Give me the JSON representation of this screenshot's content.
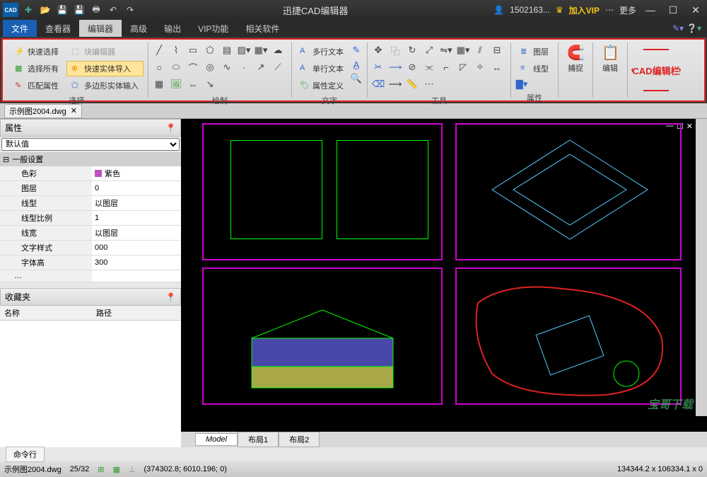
{
  "title": "迅捷CAD编辑器",
  "user": "1502163...",
  "vip_label": "加入VIP",
  "more_label": "更多",
  "menu": {
    "file": "文件",
    "items": [
      "查看器",
      "编辑器",
      "高级",
      "输出",
      "VIP功能",
      "相关软件"
    ],
    "active_index": 1
  },
  "ribbon": {
    "select": {
      "label": "选择",
      "quick_select": "快速选择",
      "block_editor": "块编辑器",
      "select_all": "选择所有",
      "quick_import": "快速实体导入",
      "match_props": "匹配属性",
      "poly_input": "多边形实体输入"
    },
    "draw": {
      "label": "绘制"
    },
    "text": {
      "label": "文字",
      "multiline": "多行文本",
      "single": "单行文本",
      "attr_def": "属性定义"
    },
    "tool": {
      "label": "工具"
    },
    "attr": {
      "label": "属性",
      "layer": "图层",
      "linetype": "线型"
    },
    "snap": "捕捉",
    "edit": "编辑",
    "editbar": "CAD编辑栏"
  },
  "document": {
    "tab": "示例图2004.dwg"
  },
  "properties": {
    "panel_title": "属性",
    "default": "默认值",
    "section": "一般设置",
    "rows": [
      {
        "label": "色彩",
        "value": "紫色"
      },
      {
        "label": "图层",
        "value": "0"
      },
      {
        "label": "线型",
        "value": "以图层"
      },
      {
        "label": "线型比例",
        "value": "1"
      },
      {
        "label": "线宽",
        "value": "以图层"
      },
      {
        "label": "文字样式",
        "value": "000"
      },
      {
        "label": "字体高",
        "value": "300"
      }
    ]
  },
  "favorites": {
    "title": "收藏夹",
    "col_name": "名称",
    "col_path": "路径"
  },
  "model_tabs": {
    "model": "Model",
    "layout1": "布局1",
    "layout2": "布局2"
  },
  "cmdline": "命令行",
  "statusbar": {
    "file": "示例图2004.dwg",
    "pages": "25/32",
    "coords": "(374302.8; 6010.196; 0)",
    "dims": "134344.2 x 106334.1 x 0"
  },
  "watermark": "宝哥下载"
}
